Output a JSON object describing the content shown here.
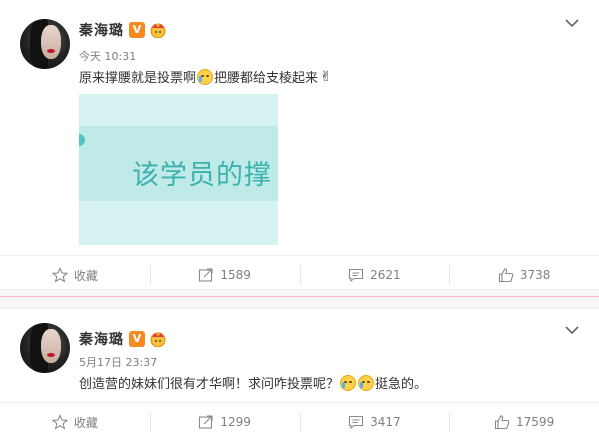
{
  "posts": [
    {
      "username": "秦海璐",
      "verified_badge": "V",
      "time": "今天 10:31",
      "content_parts": [
        "原来撑腰就是投票啊",
        "把腰都给支棱起来"
      ],
      "image_text": "该学员的撑",
      "actions": {
        "favorite": "收藏",
        "repost": "1589",
        "comment": "2621",
        "like": "3738"
      }
    },
    {
      "username": "秦海璐",
      "verified_badge": "V",
      "time": "5月17日 23:37",
      "content_parts": [
        "创造营的妹妹们很有才华啊！求问咋投票呢？",
        "挺急的。"
      ],
      "actions": {
        "favorite": "收藏",
        "repost": "1299",
        "comment": "3417",
        "like": "17599"
      }
    }
  ],
  "icons": [
    "chevron-down-icon",
    "star-icon",
    "repost-icon",
    "comment-icon",
    "like-icon",
    "crown-icon",
    "tears-of-joy-emoji",
    "victory-emoji"
  ],
  "colors": {
    "badge": "#f78a1f",
    "divider_accent": "#f4b8c6",
    "text": "#333333",
    "muted": "#808080"
  }
}
